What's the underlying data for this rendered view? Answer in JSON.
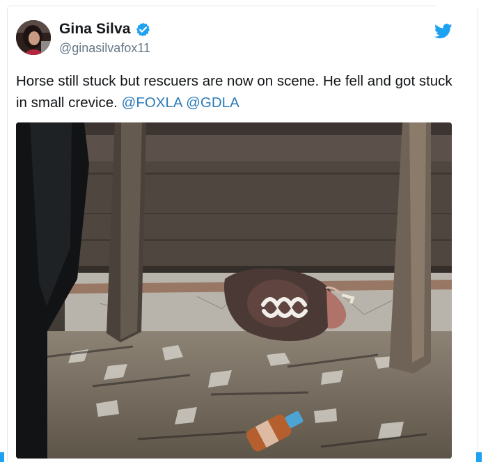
{
  "tweet": {
    "author": {
      "display_name": "Gina Silva",
      "handle": "@ginasilvafox11",
      "avatar_icon": "avatar-photo",
      "verified": true,
      "verified_icon": "verified-badge-icon"
    },
    "text_prefix": "Horse still stuck but rescuers are now on scene.  He fell and got stuck in small crevice. ",
    "mentions": [
      "@FOXLA",
      "@GDLA"
    ],
    "media": {
      "type": "photo",
      "icon": "photo"
    }
  },
  "brand": {
    "icon": "twitter-bird-icon",
    "color": "#1da1f2"
  },
  "colors": {
    "text": "#14171a",
    "secondary_text": "#657786",
    "link": "#2b7bb9",
    "border": "#e1e8ed"
  }
}
